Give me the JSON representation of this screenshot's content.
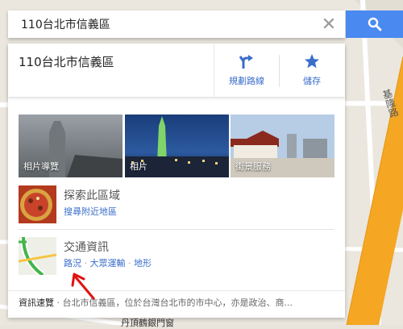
{
  "search": {
    "query": "110台北市信義區",
    "clear_icon": "close-icon",
    "search_icon": "search-icon"
  },
  "place": {
    "title": "110台北市信義區",
    "directions_label": "規劃路線",
    "save_label": "儲存"
  },
  "photos": [
    {
      "caption": "相片導覽"
    },
    {
      "caption": "相片"
    },
    {
      "caption": "街景服務"
    }
  ],
  "explore": {
    "title": "探索此區域",
    "link": "搜尋附近地區"
  },
  "traffic": {
    "title": "交通資訊",
    "links": [
      "路況",
      "大眾運輸",
      "地形"
    ],
    "separator": "·"
  },
  "footer": {
    "label": "資訊速覽",
    "text": "· 台北市信義區，位於台灣台北市的市中心，亦是政治、商..."
  },
  "map": {
    "road_label_bottom": "丹頂鶴銀門窗",
    "road_label_right": "基隆路"
  },
  "colors": {
    "accent": "#4a89f0",
    "link": "#3a6ec9",
    "road": "#f5a623",
    "annotation_arrow": "#e01010"
  }
}
